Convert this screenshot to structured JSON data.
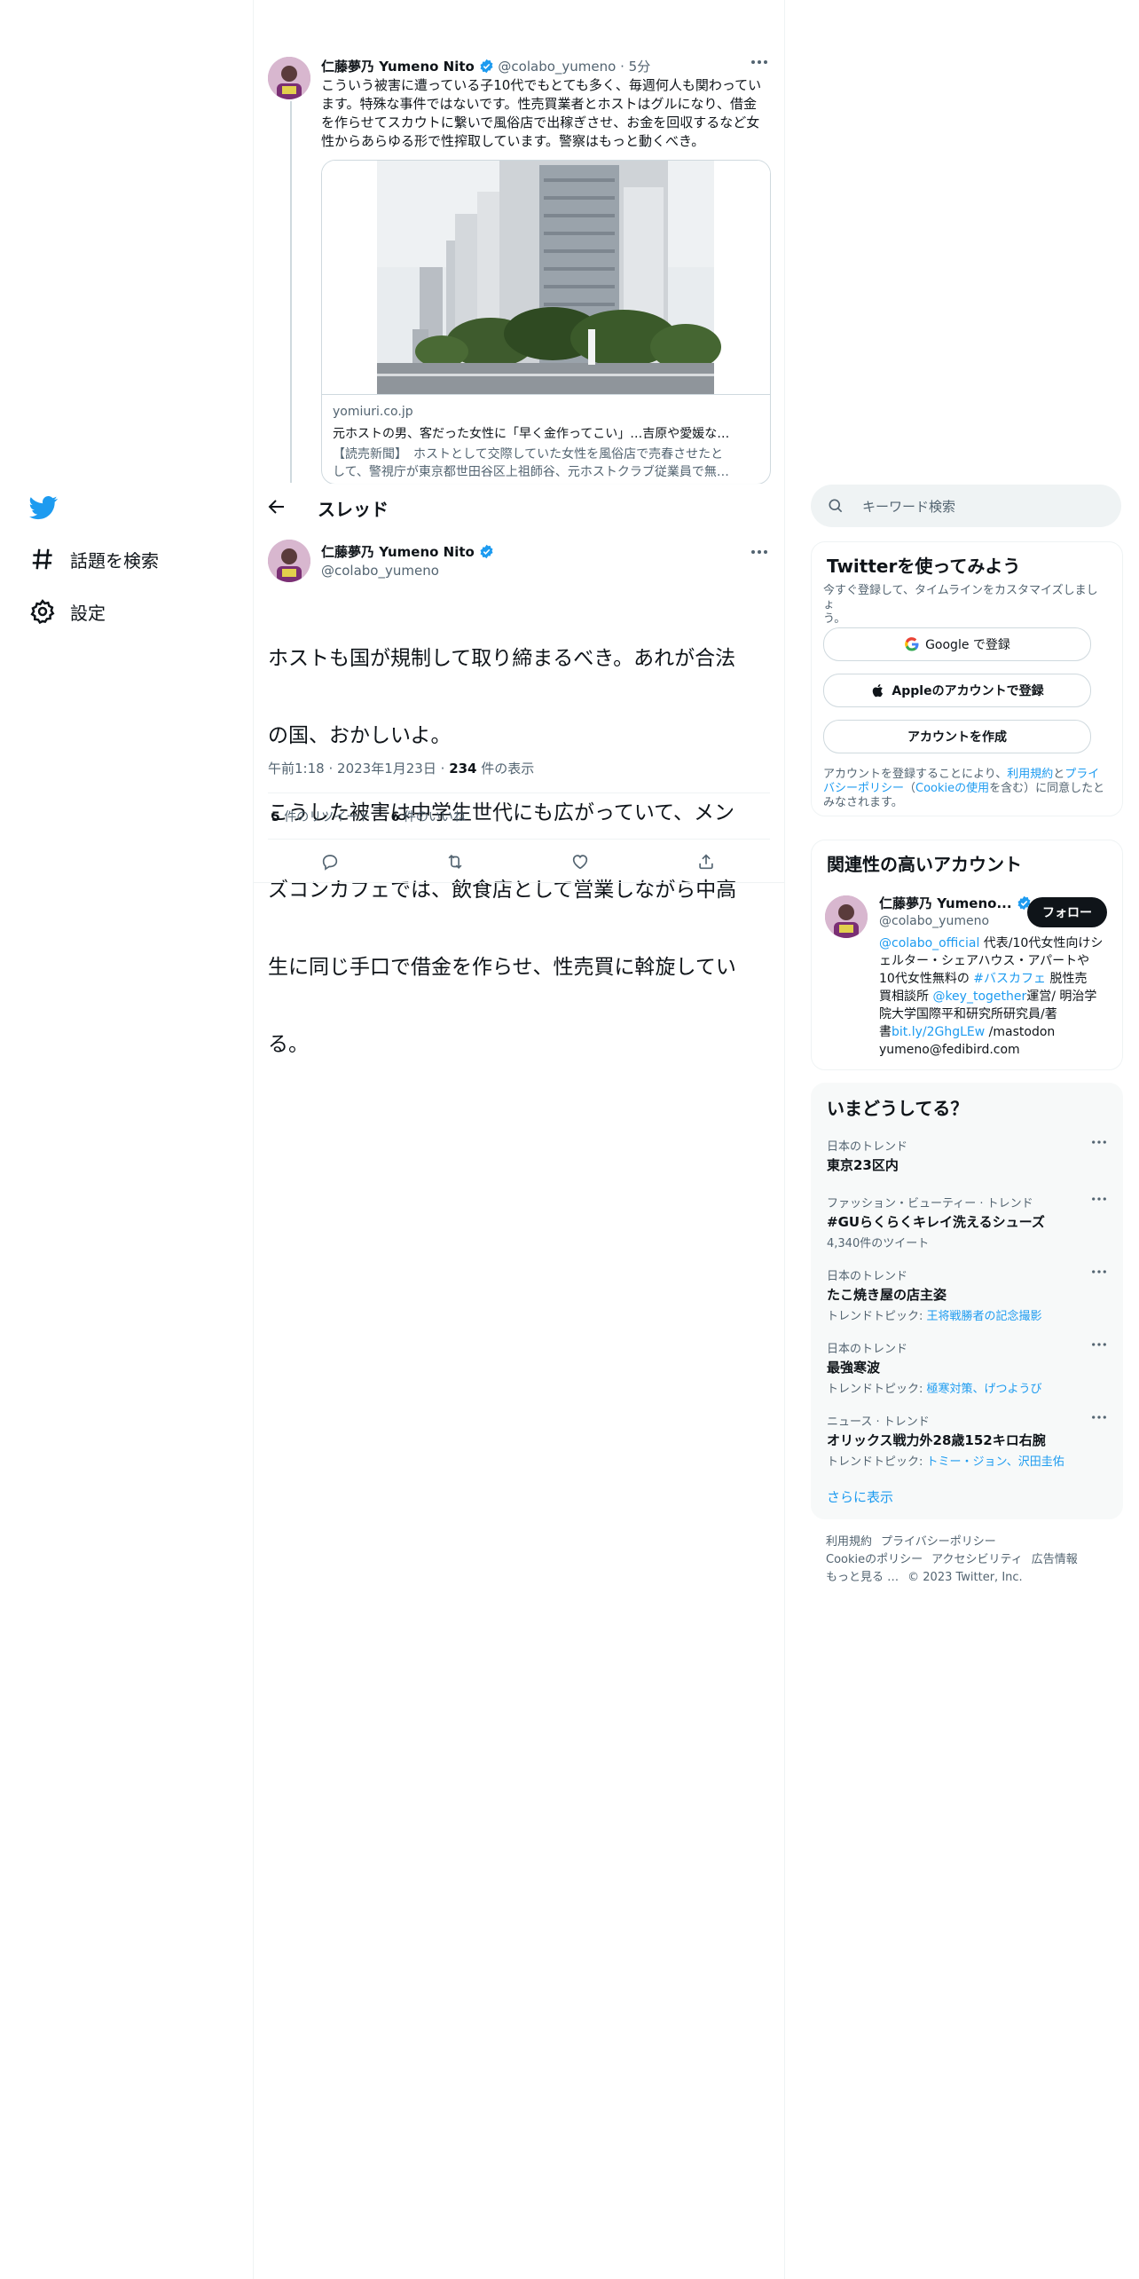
{
  "nav": {
    "items": [
      {
        "label": "話題を検索",
        "icon": "hashtag-icon"
      },
      {
        "label": "設定",
        "icon": "gear-icon"
      }
    ]
  },
  "parent_tweet": {
    "author_name": "仁藤夢乃 Yumeno Nito",
    "handle": "@colabo_yumeno",
    "sep": "·",
    "time": "5分",
    "lines": [
      "こういう被害に遭っている子10代でもとても多く、毎週何人も関わってい",
      "ます。特殊な事件ではないです。性売買業者とホストはグルになり、借金",
      "を作らせてスカウトに繋いで風俗店で出稼ぎさせ、お金を回収するなど女",
      "性からあらゆる形で性搾取しています。警察はもっと動くべき。"
    ],
    "card": {
      "domain": "yomiuri.co.jp",
      "title": "元ホストの男、客だった女性に「早く金作ってこい」…吉原や愛媛な…",
      "desc_lines": [
        "【読売新聞】　ホストとして交際していた女性を風俗店で売春させたと",
        "して、警視庁が東京都世田谷区上祖師谷、元ホストクラブ従業員で無…"
      ]
    }
  },
  "header": {
    "title": "スレッド"
  },
  "main_tweet": {
    "author_name": "仁藤夢乃 Yumeno Nito",
    "handle": "@colabo_yumeno",
    "lines": [
      "ホストも国が規制して取り締まるべき。あれが合法",
      "の国、おかしいよ。",
      "こうした被害は中学生世代にも広がっていて、メン",
      "ズコンカフェでは、飲食店として営業しながら中高",
      "生に同じ手口で借金を作らせ、性売買に斡旋してい",
      "る。"
    ],
    "time": "午前1:18",
    "sep": "·",
    "date": "2023年1月23日",
    "views_count": "234",
    "views_label": " 件の表示",
    "retweets_count": "5",
    "retweets_label": " 件のリツイート",
    "likes_count": "6",
    "likes_label": " 件のいいね"
  },
  "search": {
    "placeholder": "キーワード検索"
  },
  "signup": {
    "title": "Twitterを使ってみよう",
    "subtitle_lines": [
      "今すぐ登録して、タイムラインをカスタマイズしましょ",
      "う。"
    ],
    "google": "Google で登録",
    "apple": "Appleのアカウントで登録",
    "create": "アカウントを作成",
    "terms_pre": "アカウントを登録することにより、",
    "terms_link": "利用規約",
    "terms_and": "と",
    "privacy_link_1": "プライ",
    "privacy_link_2": "バシーポリシー",
    "cookie_pre": "（",
    "cookie_link": "Cookieの使用",
    "terms_post": "を含む）に同意したと",
    "terms_post2": "みなされます。"
  },
  "related": {
    "title": "関連性の高いアカウント",
    "name": "仁藤夢乃 Yumeno...",
    "handle": "@colabo_yumeno",
    "follow": "フォロー",
    "bio": {
      "mention1": "@colabo_official",
      "t1": " 代表/10代女性向けシ",
      "l2": "ェルター・シェアハウス・アパートや",
      "l3a": "10代女性無料の ",
      "hashtag": "#バスカフェ",
      "l3b": " 脱性売",
      "l4a": "買相談所 ",
      "mention2": "@key_together",
      "l4b": "運営/ 明治学",
      "l5": "院大学国際平和研究所研究員/著",
      "l6a": "書",
      "url": "bit.ly/2GhgLEw",
      "l6b": " /mastodon",
      "l7": "yumeno@fedibird.com"
    }
  },
  "trends": {
    "title": "いまどうしてる？",
    "items": [
      {
        "cat": "日本のトレンド",
        "name": "東京23区内",
        "sub_pre": "",
        "sub_link": ""
      },
      {
        "cat": "ファッション・ビューティー · トレンド",
        "name": "#GUらくらくキレイ洗えるシューズ",
        "sub_pre": "4,340件のツイート",
        "sub_link": ""
      },
      {
        "cat": "日本のトレンド",
        "name": "たこ焼き屋の店主姿",
        "sub_pre": "トレンドトピック: ",
        "sub_link": "王将戦勝者の記念撮影"
      },
      {
        "cat": "日本のトレンド",
        "name": "最強寒波",
        "sub_pre": "トレンドトピック: ",
        "sub_link": "極寒対策、げつようび"
      },
      {
        "cat": "ニュース · トレンド",
        "name": "オリックス戦力外28歳152キロ右腕",
        "sub_pre": "トレンドトピック: ",
        "sub_link": "トミー・ジョン、沢田圭佑"
      }
    ],
    "show_more": "さらに表示"
  },
  "footer": {
    "terms": "利用規約",
    "privacy": "プライバシーポリシー",
    "cookie": "Cookieのポリシー",
    "accessibility": "アクセシビリティ",
    "ads": "広告情報",
    "more": "もっと見る …",
    "copyright": "© 2023 Twitter, Inc."
  },
  "colors": {
    "accent": "#1d9bf0",
    "text": "#0f1419",
    "muted": "#536471",
    "border": "#eff3f4"
  }
}
